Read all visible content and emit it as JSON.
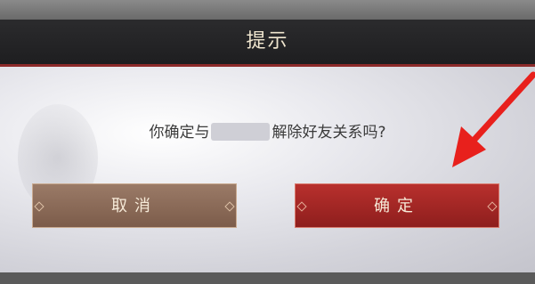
{
  "dialog": {
    "title": "提示",
    "message_prefix": "你确定与",
    "message_suffix": "解除好友关系吗?"
  },
  "buttons": {
    "cancel_label": "取消",
    "confirm_label": "确定"
  },
  "colors": {
    "confirm": "#a52523",
    "cancel": "#8b6b58",
    "header": "#252527",
    "arrow": "#e8201c"
  }
}
